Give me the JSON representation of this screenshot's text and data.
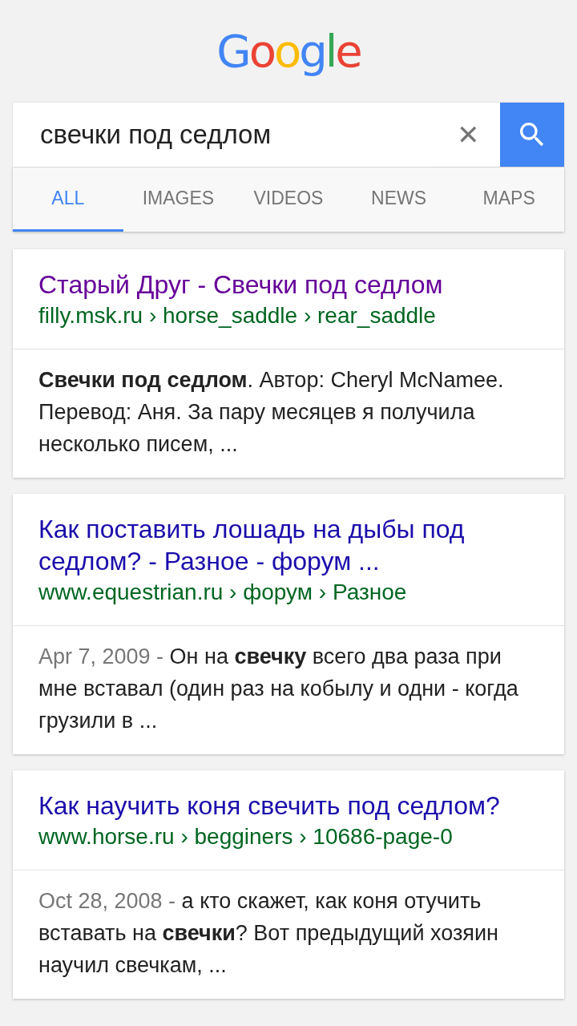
{
  "logo": "Google",
  "search": {
    "value": "свечки под седлом",
    "clear_icon": "✕"
  },
  "tabs": [
    {
      "label": "ALL",
      "selected": true
    },
    {
      "label": "IMAGES",
      "selected": false
    },
    {
      "label": "VIDEOS",
      "selected": false
    },
    {
      "label": "NEWS",
      "selected": false
    },
    {
      "label": "MAPS",
      "selected": false
    }
  ],
  "results": [
    {
      "title": "Старый Друг - Свечки под седлом",
      "visited": true,
      "url": "filly.msk.ru › horse_saddle › rear_saddle",
      "snippet": "**Свечки под седлом**. Автор: Cheryl McNamee. Перевод: Аня. За пару месяцев я получила несколько писем, ..."
    },
    {
      "title": "Как поставить лошадь на дыбы под седлом? - Разное - форум ...",
      "visited": false,
      "url": "www.equestrian.ru › форум › Разное",
      "date": "Apr 7, 2009 - ",
      "snippet": "Он на **свечку** всего два раза при мне вставал (один раз на кобылу и одни - когда грузили в ..."
    },
    {
      "title": "Как научить коня свечить под седлом?",
      "visited": false,
      "url": "www.horse.ru › begginers › 10686-page-0",
      "date": "Oct 28, 2008 - ",
      "snippet": "а кто скажет, как коня отучить вставать на **свечки**? Вот предыдущий хозяин научил свечкам, ..."
    }
  ]
}
